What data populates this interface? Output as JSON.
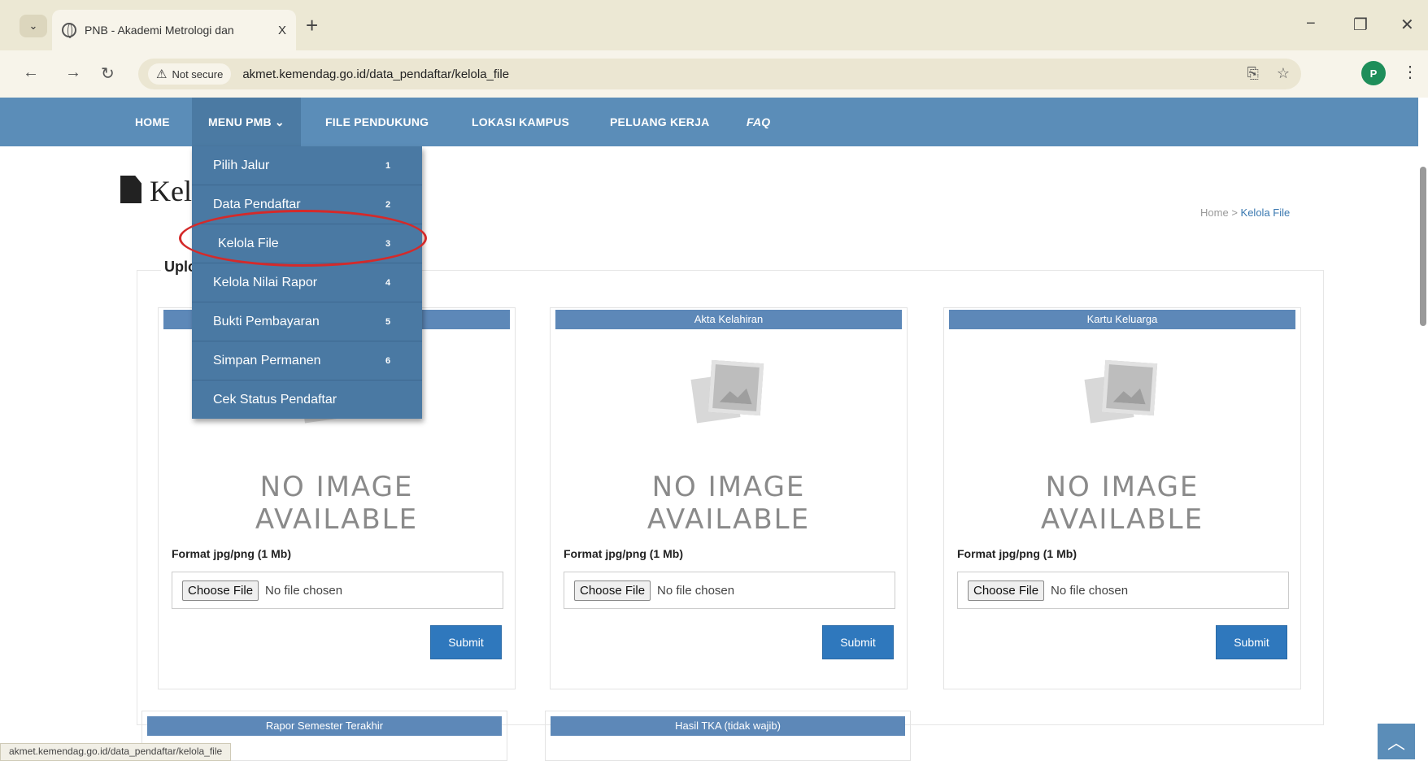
{
  "browser": {
    "tab_title": "PNB - Akademi Metrologi dan",
    "tab_close": "X",
    "new_tab": "+",
    "not_secure": "Not secure",
    "url": "akmet.kemendag.go.id/data_pendaftar/kelola_file",
    "profile_initial": "P",
    "status_url": "akmet.kemendag.go.id/data_pendaftar/kelola_file"
  },
  "navbar": {
    "items": [
      "HOME",
      "MENU PMB",
      "FILE PENDUKUNG",
      "LOKASI KAMPUS",
      "PELUANG KERJA",
      "FAQ"
    ],
    "color": "#5b8db8"
  },
  "dropdown": {
    "items": [
      {
        "label": "Pilih Jalur",
        "num": "1"
      },
      {
        "label": "Data Pendaftar",
        "num": "2"
      },
      {
        "label": "Kelola File",
        "num": "3"
      },
      {
        "label": "Kelola Nilai Rapor",
        "num": "4"
      },
      {
        "label": "Bukti Pembayaran",
        "num": "5"
      },
      {
        "label": "Simpan Permanen",
        "num": "6"
      },
      {
        "label": "Cek Status Pendaftar",
        "num": ""
      }
    ],
    "highlighted": "Kelola File"
  },
  "page": {
    "title": "Kel",
    "breadcrumb_home": "Home",
    "breadcrumb_sep": ">",
    "breadcrumb_current": "Kelola File",
    "panel_title": "Uplo"
  },
  "cards": [
    {
      "header": "",
      "no_image_1": "NO IMAGE",
      "no_image_2": "AVAILABLE",
      "format": "Format jpg/png (1 Mb)",
      "choose": "Choose File",
      "no_file": "No file chosen",
      "submit": "Submit"
    },
    {
      "header": "Akta Kelahiran",
      "no_image_1": "NO IMAGE",
      "no_image_2": "AVAILABLE",
      "format": "Format jpg/png (1 Mb)",
      "choose": "Choose File",
      "no_file": "No file chosen",
      "submit": "Submit"
    },
    {
      "header": "Kartu Keluarga",
      "no_image_1": "NO IMAGE",
      "no_image_2": "AVAILABLE",
      "format": "Format jpg/png (1 Mb)",
      "choose": "Choose File",
      "no_file": "No file chosen",
      "submit": "Submit"
    }
  ],
  "lower_cards": [
    {
      "header": "Rapor Semester Terakhir"
    },
    {
      "header": "Hasil TKA (tidak wajib)"
    }
  ]
}
